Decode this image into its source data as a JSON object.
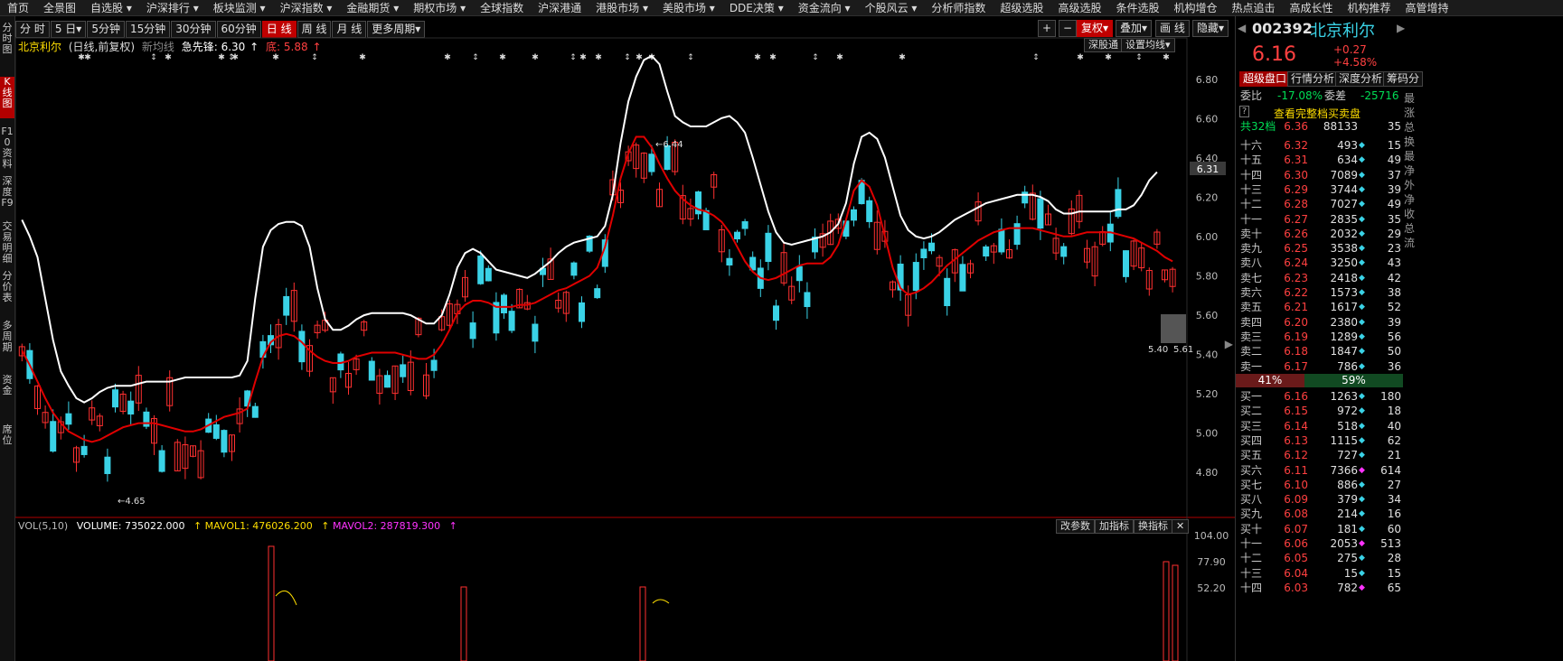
{
  "topnav": [
    "首页",
    "全景图",
    "自选股 ▾",
    "沪深排行 ▾",
    "板块监测 ▾",
    "沪深指数 ▾",
    "金融期货 ▾",
    "期权市场 ▾",
    "全球指数",
    "沪深港通",
    "港股市场 ▾",
    "美股市场 ▾",
    "DDE决策 ▾",
    "资金流向 ▾",
    "个股风云 ▾",
    "分析师指数",
    "超级选股",
    "高级选股",
    "条件选股",
    "机构增仓",
    "热点追击",
    "高成长性",
    "机构推荐",
    "高管增持"
  ],
  "left_rail": [
    "分时图",
    "K线图",
    "F10资料",
    "深度F9",
    "交易明细",
    "分价表",
    "多周期",
    "资金",
    "席位"
  ],
  "toolbar": {
    "periods": [
      "分 时",
      "5 日▾",
      "5分钟",
      "15分钟",
      "30分钟",
      "60分钟",
      "日 线",
      "周 线",
      "月 线",
      "更多周期▾"
    ],
    "active_period": "日 线",
    "right_buttons": [
      "+",
      "−",
      "复权▾",
      "叠加▾",
      "画 线",
      "隐藏▾"
    ]
  },
  "chart_header": {
    "name": "北京利尔",
    "mode": "(日线,前复权)",
    "ma_label": "新均线",
    "ind_name": "急先锋:",
    "ind_up": "6.30",
    "ind_up_arrow": "↑",
    "ind_down_name": "底:",
    "ind_down": "5.88",
    "ind_down_arrow": "↑",
    "btn_deep": "深股通",
    "btn_setma": "设置均线▾"
  },
  "price_axis": {
    "labels": [
      "6.80",
      "6.60",
      "6.40",
      "6.20",
      "6.00",
      "5.80",
      "5.60",
      "5.40",
      "5.20",
      "5.00",
      "4.80"
    ],
    "current_tag": "6.31"
  },
  "chart_data": {
    "type": "candlestick",
    "x_count": 150,
    "y_range": [
      4.65,
      6.9
    ],
    "annotations": [
      {
        "label": "6.44",
        "type": "high"
      },
      {
        "label": "4.65",
        "type": "low"
      },
      {
        "label": "5.40",
        "type": "low"
      },
      {
        "label": "5.61",
        "type": "price"
      }
    ],
    "upper_band": [
      6.08,
      6.0,
      5.9,
      5.7,
      5.5,
      5.35,
      5.28,
      5.22,
      5.2,
      5.22,
      5.25,
      5.27,
      5.28,
      5.28,
      5.28,
      5.29,
      5.3,
      5.3,
      5.3,
      5.3,
      5.31,
      5.32,
      5.32,
      5.32,
      5.32,
      5.32,
      5.32,
      5.32,
      5.33,
      5.4,
      5.7,
      5.95,
      6.03,
      6.06,
      6.07,
      6.07,
      6.05,
      5.95,
      5.75,
      5.6,
      5.55,
      5.55,
      5.57,
      5.6,
      5.62,
      5.63,
      5.63,
      5.63,
      5.63,
      5.63,
      5.62,
      5.6,
      5.58,
      5.58,
      5.62,
      5.72,
      5.85,
      5.92,
      5.94,
      5.92,
      5.88,
      5.84,
      5.83,
      5.82,
      5.81,
      5.8,
      5.82,
      5.85,
      5.88,
      5.92,
      5.95,
      5.97,
      5.98,
      5.99,
      6.0,
      6.05,
      6.2,
      6.45,
      6.65,
      6.77,
      6.85,
      6.87,
      6.83,
      6.7,
      6.58,
      6.55,
      6.53,
      6.53,
      6.53,
      6.55,
      6.57,
      6.58,
      6.55,
      6.5,
      6.38,
      6.25,
      6.12,
      6.02,
      5.97,
      5.96,
      5.97,
      5.98,
      5.99,
      6.0,
      6.02,
      6.06,
      6.16,
      6.35,
      6.48,
      6.5,
      6.47,
      6.38,
      6.24,
      6.1,
      6.03,
      6.0,
      5.99,
      6.0,
      6.02,
      6.05,
      6.08,
      6.1,
      6.12,
      6.14,
      6.16,
      6.17,
      6.18,
      6.19,
      6.2,
      6.2,
      6.2,
      6.19,
      6.17,
      6.13,
      6.11,
      6.11,
      6.12,
      6.12,
      6.12,
      6.12,
      6.12,
      6.13,
      6.13,
      6.15,
      6.2,
      6.27,
      6.31
    ],
    "mid_band": [
      5.45,
      5.38,
      5.3,
      5.22,
      5.15,
      5.1,
      5.06,
      5.04,
      5.02,
      5.01,
      5.02,
      5.04,
      5.06,
      5.08,
      5.09,
      5.1,
      5.1,
      5.1,
      5.09,
      5.08,
      5.07,
      5.06,
      5.06,
      5.07,
      5.09,
      5.11,
      5.13,
      5.14,
      5.15,
      5.17,
      5.3,
      5.42,
      5.49,
      5.52,
      5.53,
      5.52,
      5.49,
      5.45,
      5.42,
      5.4,
      5.39,
      5.39,
      5.4,
      5.42,
      5.43,
      5.44,
      5.44,
      5.44,
      5.44,
      5.43,
      5.42,
      5.41,
      5.41,
      5.43,
      5.48,
      5.55,
      5.63,
      5.67,
      5.69,
      5.69,
      5.68,
      5.66,
      5.66,
      5.66,
      5.67,
      5.67,
      5.68,
      5.7,
      5.72,
      5.74,
      5.75,
      5.77,
      5.79,
      5.81,
      5.85,
      5.95,
      6.1,
      6.28,
      6.4,
      6.48,
      6.48,
      6.43,
      6.35,
      6.28,
      6.22,
      6.18,
      6.15,
      6.13,
      6.12,
      6.1,
      6.07,
      6.02,
      5.95,
      5.88,
      5.83,
      5.8,
      5.79,
      5.8,
      5.82,
      5.84,
      5.86,
      5.87,
      5.87,
      5.87,
      5.9,
      5.96,
      6.08,
      6.22,
      6.27,
      6.24,
      6.15,
      6.0,
      5.85,
      5.75,
      5.72,
      5.73,
      5.75,
      5.78,
      5.82,
      5.86,
      5.89,
      5.92,
      5.95,
      5.98,
      6.0,
      6.02,
      6.03,
      6.04,
      6.04,
      6.04,
      6.04,
      6.03,
      6.02,
      6.01,
      6.0,
      6.0,
      6.01,
      6.02,
      6.02,
      6.02,
      6.02,
      6.01,
      6.0,
      5.99,
      5.97,
      5.95,
      5.93,
      5.9,
      5.88
    ]
  },
  "volume_header": {
    "name": "VOL(5,10)",
    "vol_label": "VOLUME: 735022.000",
    "ma1_arrow": "↑",
    "ma1": "MAVOL1: 476026.200",
    "ma1_arrow2": "↑",
    "ma2": "MAVOL2: 287819.300",
    "ma2_arrow": "↑",
    "btns": [
      "改参数",
      "加指标",
      "换指标",
      "✕"
    ]
  },
  "volume_axis": [
    "104.00",
    "77.90",
    "52.20"
  ],
  "stock": {
    "code": "002392",
    "name": "北京利尔",
    "price": "6.16",
    "change": "+0.27",
    "change_pct": "+4.58%"
  },
  "panel_tabs": [
    "超级盘口",
    "行情分析",
    "深度分析",
    "筹码分"
  ],
  "weibi": {
    "label1": "委比",
    "value1": "-17.08%",
    "label2": "委差",
    "value2": "-25716"
  },
  "orderbook_link": "查看完整档买卖盘",
  "total_level": {
    "label": "共32档",
    "price": "6.36",
    "vol": "88133",
    "cnt": "35"
  },
  "asks": [
    {
      "label": "十六",
      "price": "6.32",
      "vol": "493",
      "cnt": "15"
    },
    {
      "label": "十五",
      "price": "6.31",
      "vol": "634",
      "cnt": "49"
    },
    {
      "label": "十四",
      "price": "6.30",
      "vol": "7089",
      "cnt": "37"
    },
    {
      "label": "十三",
      "price": "6.29",
      "vol": "3744",
      "cnt": "39"
    },
    {
      "label": "十二",
      "price": "6.28",
      "vol": "7027",
      "cnt": "49"
    },
    {
      "label": "十一",
      "price": "6.27",
      "vol": "2835",
      "cnt": "35"
    },
    {
      "label": "卖十",
      "price": "6.26",
      "vol": "2032",
      "cnt": "29"
    },
    {
      "label": "卖九",
      "price": "6.25",
      "vol": "3538",
      "cnt": "23"
    },
    {
      "label": "卖八",
      "price": "6.24",
      "vol": "3250",
      "cnt": "43"
    },
    {
      "label": "卖七",
      "price": "6.23",
      "vol": "2418",
      "cnt": "42"
    },
    {
      "label": "卖六",
      "price": "6.22",
      "vol": "1573",
      "cnt": "38"
    },
    {
      "label": "卖五",
      "price": "6.21",
      "vol": "1617",
      "cnt": "52"
    },
    {
      "label": "卖四",
      "price": "6.20",
      "vol": "2380",
      "cnt": "39"
    },
    {
      "label": "卖三",
      "price": "6.19",
      "vol": "1289",
      "cnt": "56"
    },
    {
      "label": "卖二",
      "price": "6.18",
      "vol": "1847",
      "cnt": "50"
    },
    {
      "label": "卖一",
      "price": "6.17",
      "vol": "786",
      "cnt": "36"
    }
  ],
  "ratio": {
    "left": "41%",
    "right": "59%"
  },
  "bids": [
    {
      "label": "买一",
      "price": "6.16",
      "vol": "1263",
      "cnt": "180"
    },
    {
      "label": "买二",
      "price": "6.15",
      "vol": "972",
      "cnt": "18"
    },
    {
      "label": "买三",
      "price": "6.14",
      "vol": "518",
      "cnt": "40"
    },
    {
      "label": "买四",
      "price": "6.13",
      "vol": "1115",
      "cnt": "62"
    },
    {
      "label": "买五",
      "price": "6.12",
      "vol": "727",
      "cnt": "21"
    },
    {
      "label": "买六",
      "price": "6.11",
      "vol": "7366",
      "cnt": "614"
    },
    {
      "label": "买七",
      "price": "6.10",
      "vol": "886",
      "cnt": "27"
    },
    {
      "label": "买八",
      "price": "6.09",
      "vol": "379",
      "cnt": "34"
    },
    {
      "label": "买九",
      "price": "6.08",
      "vol": "214",
      "cnt": "16"
    },
    {
      "label": "买十",
      "price": "6.07",
      "vol": "181",
      "cnt": "60"
    },
    {
      "label": "十一",
      "price": "6.06",
      "vol": "2053",
      "cnt": "513"
    },
    {
      "label": "十二",
      "price": "6.05",
      "vol": "275",
      "cnt": "28"
    },
    {
      "label": "十三",
      "price": "6.04",
      "vol": "15",
      "cnt": "15"
    },
    {
      "label": "十四",
      "price": "6.03",
      "vol": "782",
      "cnt": "65"
    }
  ],
  "side_column": [
    "最",
    "涨",
    "总",
    "换",
    "最",
    "净",
    "外",
    "净",
    "收",
    "总",
    "流"
  ],
  "colors": {
    "up": "#ff3030",
    "down": "#3ad2e6",
    "mid_line": "#e00000",
    "upper_line": "#ffffff",
    "accent": "#c00000"
  }
}
